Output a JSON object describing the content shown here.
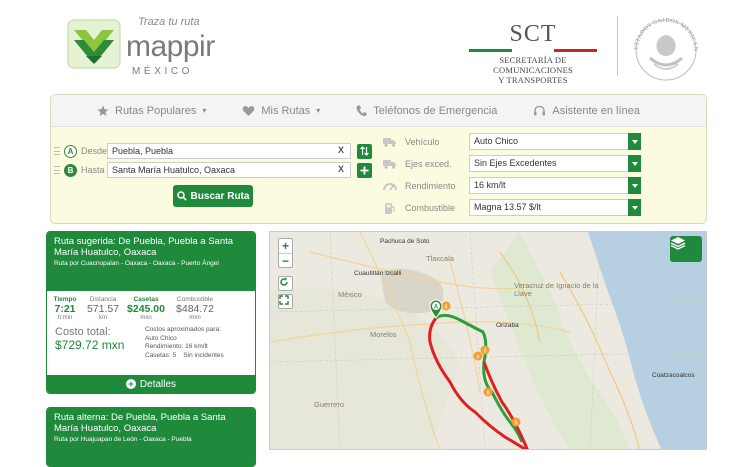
{
  "brand": {
    "tagline": "Traza tu ruta",
    "name": "mappir",
    "country": "MÉXICO",
    "colors": {
      "primary": "#1f8a3b",
      "light": "#8cc63f"
    }
  },
  "agency": {
    "acronym": "SCT",
    "line1": "SECRETARÍA DE",
    "line2": "COMUNICACIONES",
    "line3": "Y TRANSPORTES",
    "seal_text": "ESTADOS UNIDOS MEXICANOS"
  },
  "nav": [
    {
      "label": "Rutas Populares",
      "icon": "star-icon",
      "caret": "▾"
    },
    {
      "label": "Mis Rutas",
      "icon": "heart-icon",
      "caret": "▾"
    },
    {
      "label": "Teléfonos de Emergencia",
      "icon": "phone-icon",
      "caret": ""
    },
    {
      "label": "Asistente en línea",
      "icon": "headset-icon",
      "caret": ""
    }
  ],
  "search": {
    "origin_label": "Desde",
    "origin_pin": "A",
    "origin_value": "Puebla, Puebla",
    "dest_label": "Hasta",
    "dest_pin": "B",
    "dest_value": "Santa María Huatulco, Oaxaca",
    "clear": "X",
    "submit": "Buscar Ruta"
  },
  "options": {
    "vehicle_label": "Vehículo",
    "vehicle_value": "Auto Chico",
    "axles_label": "Ejes exced.",
    "axles_value": "Sin Ejes Excedentes",
    "yield_label": "Rendimiento",
    "yield_value": "16 km/lt",
    "fuel_label": "Combustible",
    "fuel_value": "Magna 13.57 $/lt"
  },
  "suggested": {
    "title": "Ruta sugerida: De Puebla, Puebla a Santa María Huatulco, Oaxaca",
    "via": "Ruta por Cuacnopalan - Oaxaca - Oaxaca - Puerto Ángel",
    "time_label": "Tiempo",
    "time_value": "7:21",
    "time_unit": "h:min",
    "dist_label": "Distancia",
    "dist_value": "571.57",
    "dist_unit": "km",
    "tolls_label": "Casetas",
    "tolls_value": "$245.00",
    "tolls_unit": "mxn",
    "fuel_label": "Combustible",
    "fuel_value": "$484.72",
    "fuel_unit": "mxn",
    "total_label": "Costo total:",
    "total_value": "$729.72 mxn",
    "notes": [
      "Costos aproximados para:",
      "Auto Chico",
      "Rendimiento: 16 km/lt",
      "Casetas: 5    Sin incidentes"
    ],
    "details_label": "Detalles"
  },
  "alternate": {
    "title": "Ruta alterna: De Puebla, Puebla a Santa María Huatulco, Oaxaca",
    "via": "Ruta por Huajuapan de León - Oaxaca - Puebla"
  },
  "map": {
    "zoom_in": "+",
    "zoom_out": "−",
    "labels": {
      "pachuca": "Pachuca de Soto",
      "cuautitlan": "Cuautitlán Izcalli",
      "mexico": "México",
      "tlaxcala": "Tlaxcala",
      "veracruz": "Veracruz de Ignacio de la Llave",
      "orizaba": "Orizaba",
      "morelos": "Morelos",
      "guerrero": "Guerrero",
      "coatzacoalcos": "Coatzacoalcos"
    },
    "marker": "A",
    "shield_text": "8",
    "route_colors": {
      "suggested": "#2e9e3a",
      "alternate": "#e02020"
    }
  }
}
